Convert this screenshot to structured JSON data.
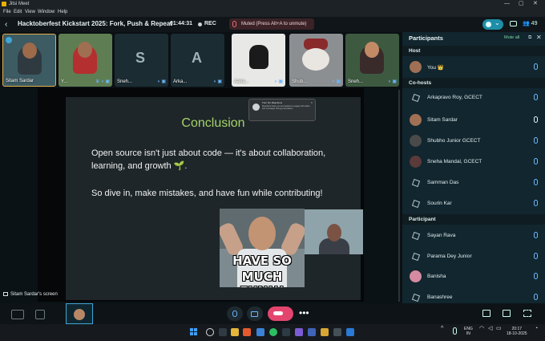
{
  "window": {
    "app_title": "Jitsi Meet",
    "controls": [
      "—",
      "▢",
      "✕"
    ]
  },
  "menu": [
    "File",
    "Edit",
    "View",
    "Window",
    "Help"
  ],
  "meeting": {
    "title": "Hacktoberfest Kickstart 2025: Fork, Push & Repeat",
    "timer": "01:44:31",
    "rec": "REC",
    "muted_banner": "Muted (Press Alt+A to unmute)",
    "participant_count": "49"
  },
  "strip": [
    {
      "name": "Sitam Sardar",
      "kind": "video"
    },
    {
      "name": "Y...",
      "kind": "video"
    },
    {
      "name": "Sneh...",
      "kind": "logo",
      "glyph": "S"
    },
    {
      "name": "Arka...",
      "kind": "logo",
      "glyph": "A"
    },
    {
      "name": "Aaka...",
      "kind": "video"
    },
    {
      "name": "Shub...",
      "kind": "video"
    },
    {
      "name": "Sneh...",
      "kind": "video"
    }
  ],
  "slide": {
    "title": "Conclusion",
    "para1": "Open source isn't just about code — it's about collaboration, learning, and growth 🌱.",
    "para2": "So dive in, make mistakes, and have fun while contributing!"
  },
  "popup": {
    "title": "Turn On Reactions",
    "body": "Reactions helps you and audience engage with slides and messages during presentation.",
    "close": "×"
  },
  "gif": {
    "line1": "HAVE SO",
    "line2": "MUCH FUN!!!"
  },
  "screen_label": "Sitam Sardar's screen",
  "panel": {
    "title": "Participants",
    "mute_all": "Mute all",
    "sections": {
      "host": "Host",
      "cohosts": "Co-hosts",
      "participant": "Participant"
    },
    "host": [
      {
        "name": "You 👑",
        "avatar": "photo",
        "mic": "off"
      }
    ],
    "cohosts": [
      {
        "name": "Arkapravo Roy, GCECT",
        "avatar": "logo",
        "mic": "off"
      },
      {
        "name": "Sitam Sardar",
        "avatar": "photo",
        "mic": "on"
      },
      {
        "name": "Shubho Junior GCECT",
        "avatar": "photo",
        "mic": "off"
      },
      {
        "name": "Sneha Mandal, GCECT",
        "avatar": "photo",
        "mic": "off"
      },
      {
        "name": "Samman Das",
        "avatar": "logo",
        "mic": "off"
      },
      {
        "name": "Sourin Kar",
        "avatar": "logo",
        "mic": "off"
      }
    ],
    "participants": [
      {
        "name": "Sayan Rava",
        "avatar": "logo",
        "mic": "off"
      },
      {
        "name": "Parama Dey Junior",
        "avatar": "logo",
        "mic": "off"
      },
      {
        "name": "Banisha",
        "avatar": "photo",
        "mic": "off"
      },
      {
        "name": "Banashree",
        "avatar": "logo",
        "mic": "off"
      }
    ]
  },
  "tray": {
    "lang": "ENG",
    "region": "IN",
    "time": "20:17",
    "date": "18-10-2025"
  }
}
